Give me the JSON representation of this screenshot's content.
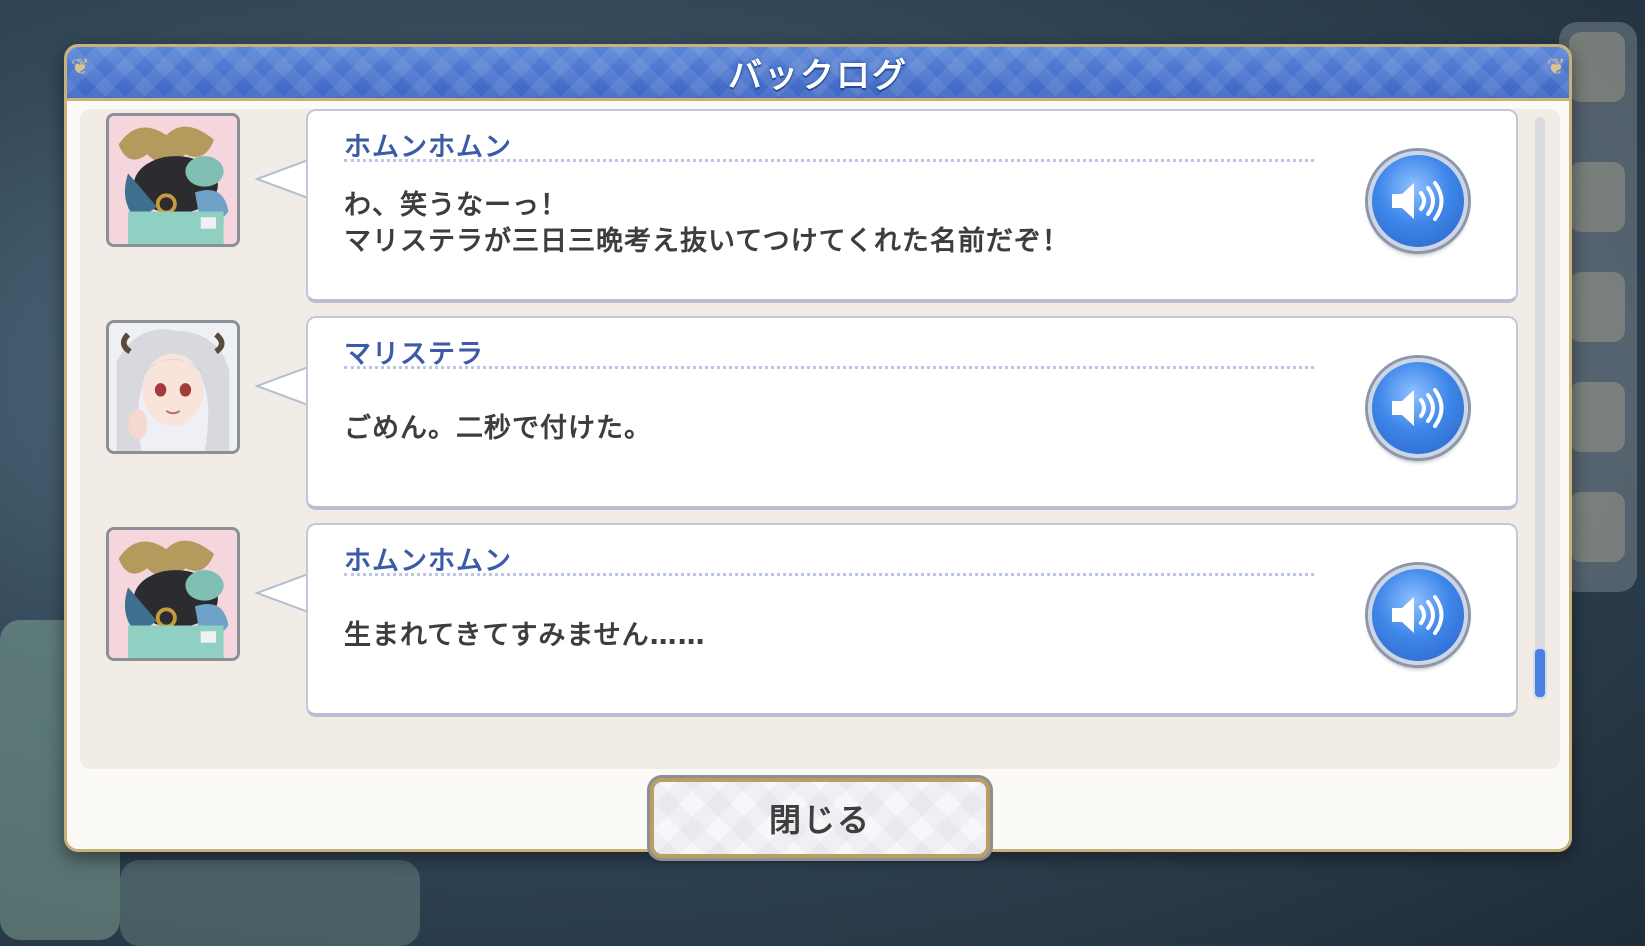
{
  "dialog": {
    "title": "バックログ",
    "close_label": "閉じる"
  },
  "entries": [
    {
      "speaker": "ホムンホムン",
      "lines": [
        "わ、笑うなーっ！",
        "マリステラが三日三晩考え抜いてつけてくれた名前だぞ！"
      ],
      "portrait_icon": "beast-character-portrait"
    },
    {
      "speaker": "マリステラ",
      "lines": [
        "ごめん。二秒で付けた。"
      ],
      "portrait_icon": "silver-haired-girl-portrait"
    },
    {
      "speaker": "ホムンホムン",
      "lines": [
        "生まれてきてすみません……"
      ],
      "portrait_icon": "beast-character-portrait"
    }
  ],
  "colors": {
    "header_blue": "#3d66c4",
    "speaker_blue": "#3c5aa8",
    "gold_border": "#c9b27a",
    "voice_button": "#3f87ea"
  },
  "icons": {
    "voice": "speaker-volume-icon"
  }
}
